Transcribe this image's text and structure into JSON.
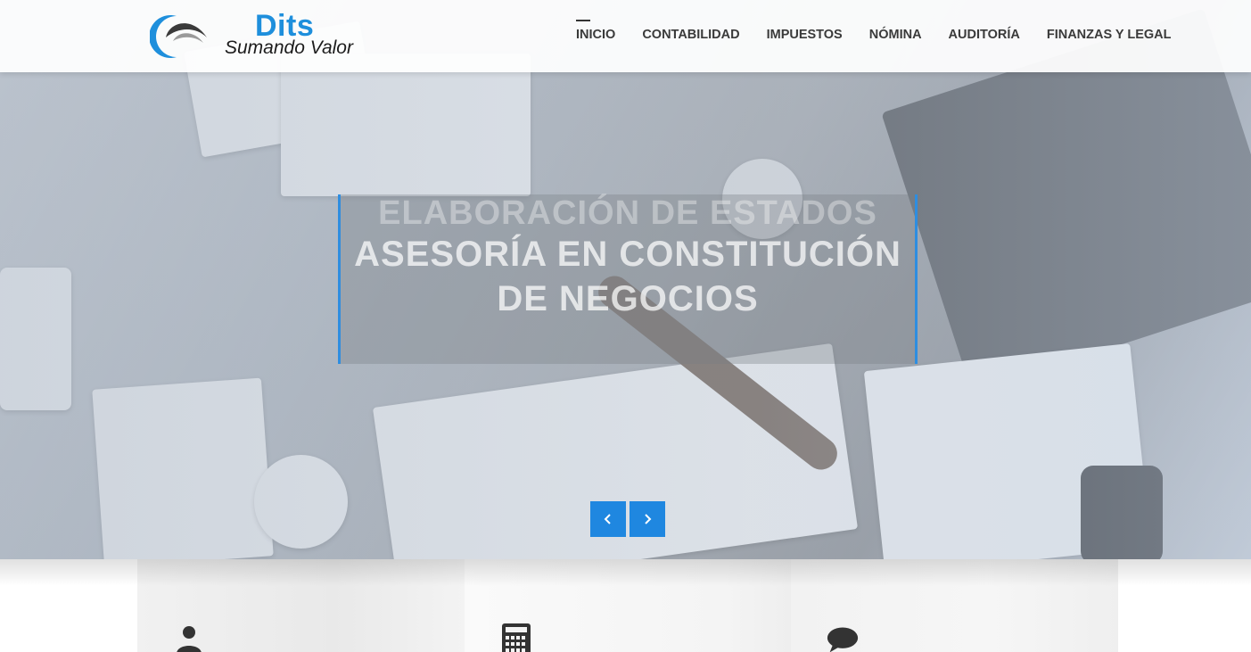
{
  "brand": {
    "name": "Dits",
    "tagline": "Sumando Valor",
    "accent": "#1e8fdc"
  },
  "nav": {
    "items": [
      {
        "label": "INICIO",
        "active": true
      },
      {
        "label": "CONTABILIDAD",
        "active": false
      },
      {
        "label": "IMPUESTOS",
        "active": false
      },
      {
        "label": "NÓMINA",
        "active": false
      },
      {
        "label": "AUDITORÍA",
        "active": false
      },
      {
        "label": "FINANZAS Y LEGAL",
        "active": false
      }
    ]
  },
  "slider": {
    "previous_caption": "ELABORACIÓN DE ESTADOS",
    "caption_line1": "ASESORÍA EN CONSTITUCIÓN",
    "caption_line2": "DE NEGOCIOS",
    "prev_icon": "chevron-left-icon",
    "next_icon": "chevron-right-icon",
    "arrow_color": "#1f87e0",
    "border_color": "#2e8de0"
  },
  "features": [
    {
      "icon": "user-icon"
    },
    {
      "icon": "calculator-icon"
    },
    {
      "icon": "speech-bubble-icon"
    }
  ]
}
